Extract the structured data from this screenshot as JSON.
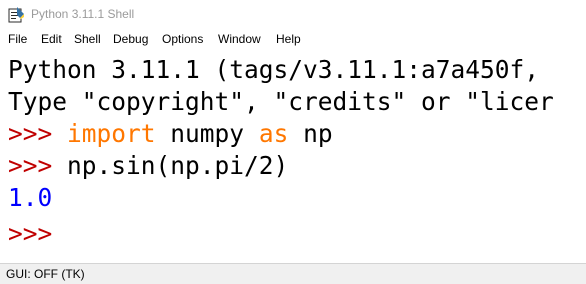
{
  "window": {
    "title": "Python 3.11.1 Shell"
  },
  "menubar": {
    "items": [
      "File",
      "Edit",
      "Shell",
      "Debug",
      "Options",
      "Window",
      "Help"
    ]
  },
  "shell": {
    "banner_line_1": "Python 3.11.1 (tags/v3.11.1:a7a450f,",
    "banner_line_2": "Type \"copyright\", \"credits\" or \"licer",
    "prompt": ">>>",
    "input_1": {
      "keyword_import": "import",
      "module": " numpy ",
      "keyword_as": "as",
      "alias": " np"
    },
    "input_2": "np.sin(np.pi/2)",
    "output_1": "1.0"
  },
  "statusbar": {
    "text": "GUI: OFF (TK)"
  },
  "colors": {
    "prompt": "#c00000",
    "keyword": "#ff7700",
    "output": "#0000ff",
    "text": "#000000"
  },
  "icons": {
    "app_icon": "idle-python-icon"
  }
}
